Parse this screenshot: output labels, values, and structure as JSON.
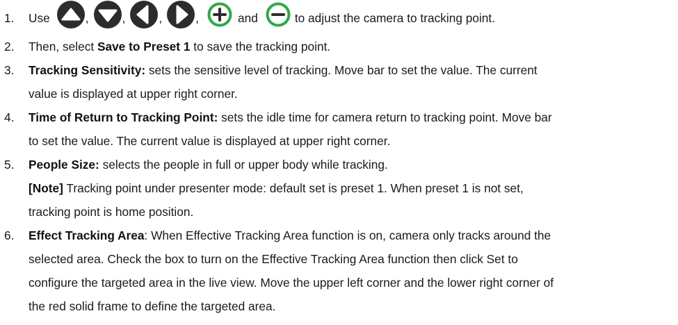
{
  "colors": {
    "icon_fill": "#2c2c2c",
    "zoom_ring": "#2fa84a"
  },
  "items": [
    {
      "num": "1.",
      "segments": {
        "use": "Use",
        "comma": ",",
        "and": "and",
        "tail": "to adjust the camera to tracking point."
      },
      "icons": [
        "up-arrow-icon",
        "down-arrow-icon",
        "left-arrow-icon",
        "right-arrow-icon",
        "zoom-in-icon",
        "zoom-out-icon"
      ]
    },
    {
      "num": "2.",
      "pre": "Then, select ",
      "bold": "Save to Preset 1",
      "post": " to save the tracking point."
    },
    {
      "num": "3.",
      "bold": "Tracking Sensitivity:",
      "post_line1": " sets the sensitive level of tracking. Move bar to set the value. The current",
      "line2": "value is displayed at upper right corner."
    },
    {
      "num": "4.",
      "bold": "Time of Return to Tracking Point:",
      "post_line1": " sets the idle time for camera return to tracking point. Move bar",
      "line2": "to set the value. The current value is displayed at upper right corner."
    },
    {
      "num": "5.",
      "bold": "People Size:",
      "post_line1": " selects the people in full or upper body while tracking.",
      "note_bold": "[Note]",
      "note_line1": " Tracking point under presenter mode: default set is preset 1. When preset 1 is not set,",
      "note_line2": "tracking point is home position."
    },
    {
      "num": "6.",
      "bold": "Effect Tracking Area",
      "post_line1": ": When Effective Tracking Area function is on, camera only tracks around the",
      "line2": "selected area. Check the box to turn on the Effective Tracking Area function then click Set to",
      "line3": "configure the targeted area in the live view. Move the upper left corner and the lower right corner of",
      "line4": "the red solid frame to define the targeted area."
    }
  ]
}
